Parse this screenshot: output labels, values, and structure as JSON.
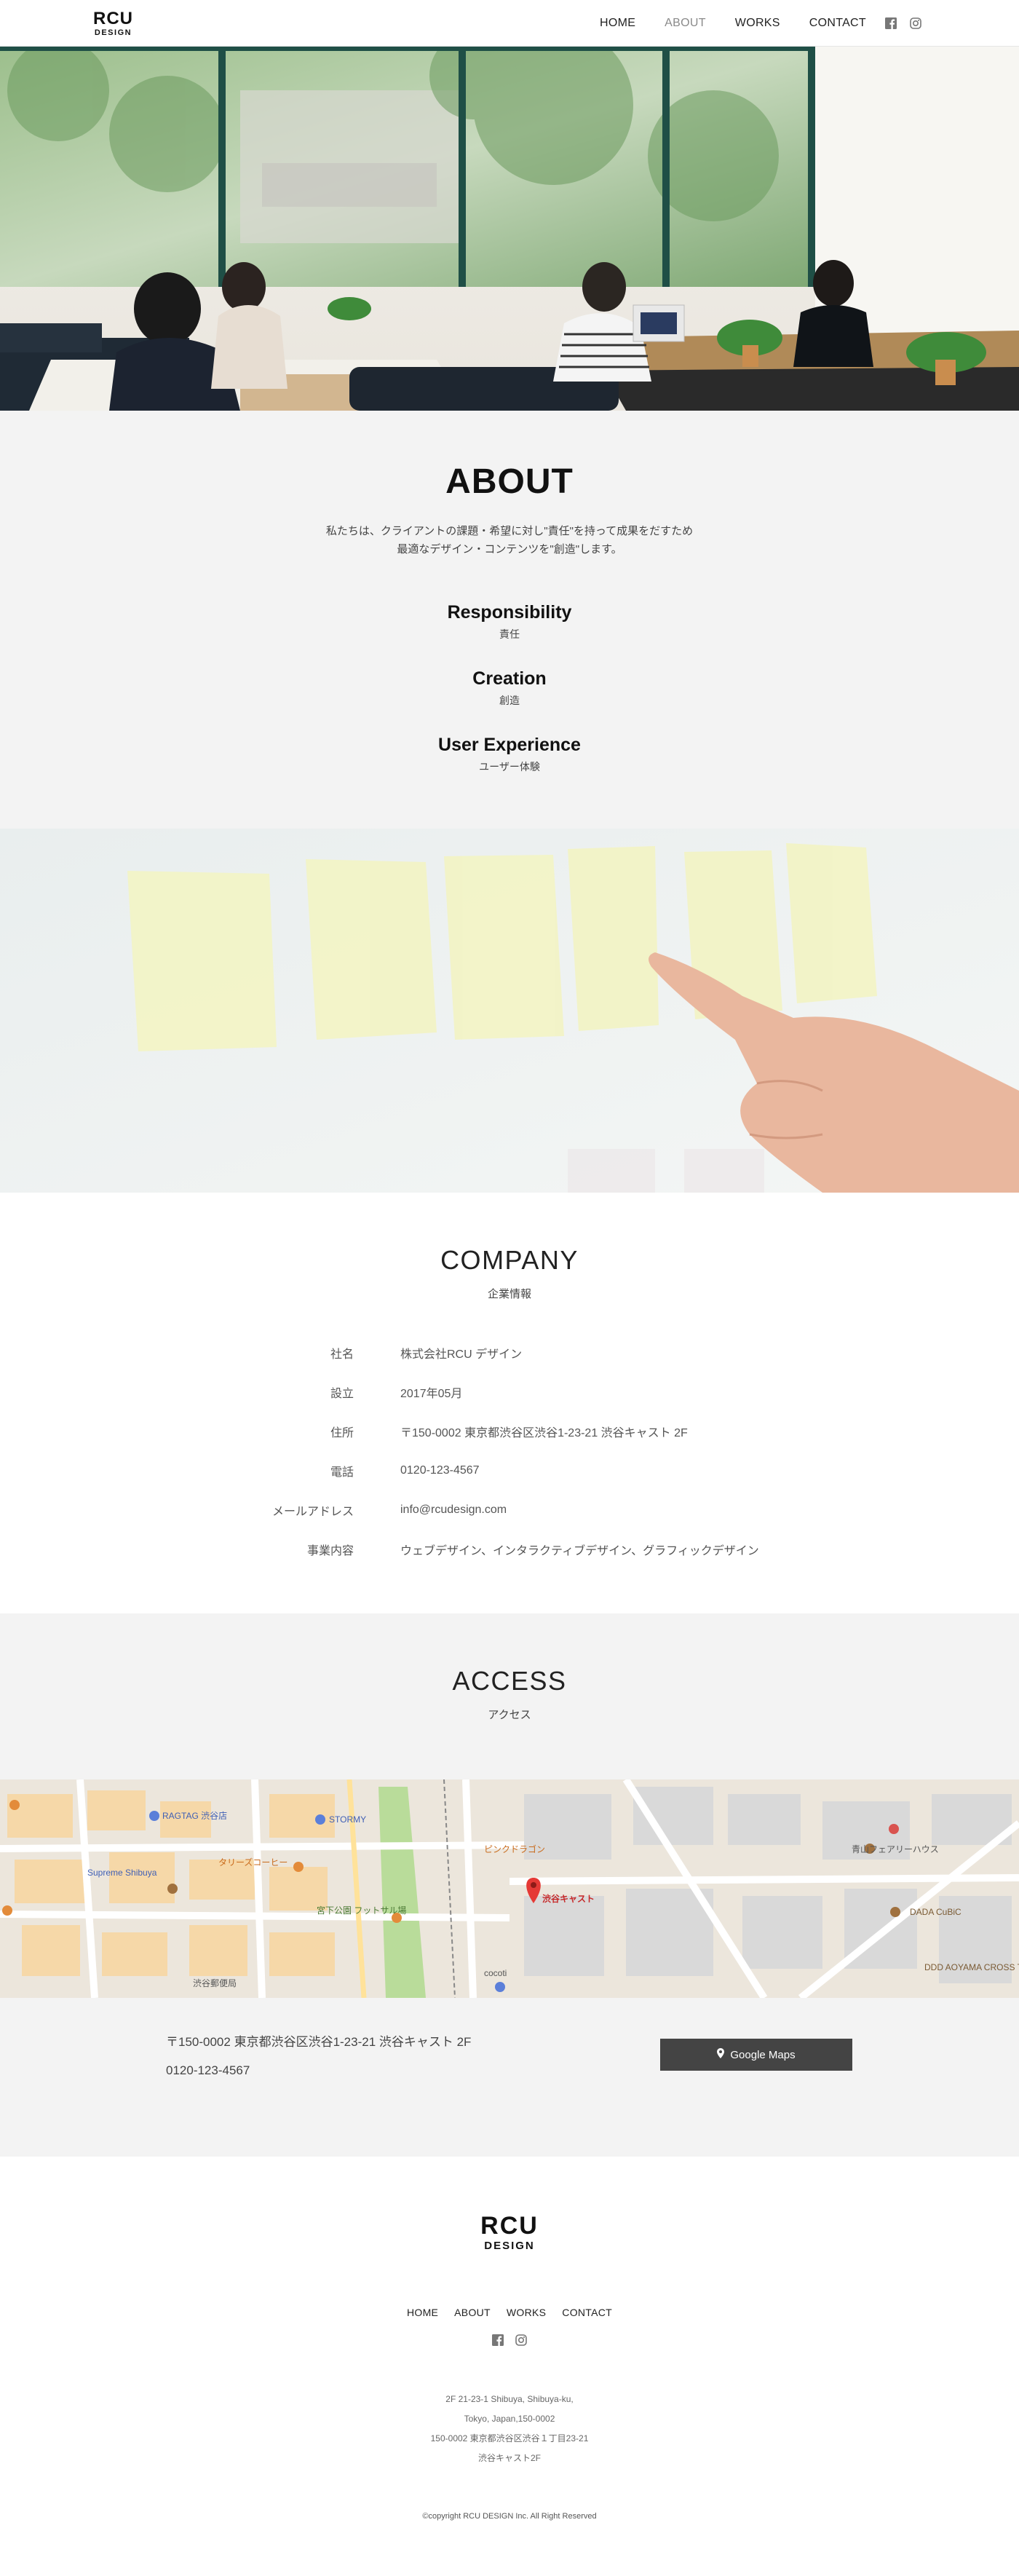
{
  "header": {
    "logo_line1": "RCU",
    "logo_line2": "DESIGN",
    "nav": [
      "HOME",
      "ABOUT",
      "WORKS",
      "CONTACT"
    ],
    "active_nav": "ABOUT",
    "social_icons": [
      "facebook-icon",
      "instagram-icon"
    ]
  },
  "about": {
    "title": "ABOUT",
    "lead_line1": "私たちは、クライアントの課題・希望に対し\"責任\"を持って成果をだすため",
    "lead_line2": "最適なデザイン・コンテンツを\"創造\"します。",
    "pillars": [
      {
        "title": "Responsibility",
        "sub": "責任"
      },
      {
        "title": "Creation",
        "sub": "創造"
      },
      {
        "title": "User Experience",
        "sub": "ユーザー体験"
      }
    ]
  },
  "company": {
    "title": "COMPANY",
    "subtitle": "企業情報",
    "rows": [
      {
        "label": "社名",
        "value": "株式会社RCU デザイン"
      },
      {
        "label": "設立",
        "value": "2017年05月"
      },
      {
        "label": "住所",
        "value": "〒150-0002 東京都渋谷区渋谷1-23-21 渋谷キャスト 2F"
      },
      {
        "label": "電話",
        "value": "0120-123-4567"
      },
      {
        "label": "メールアドレス",
        "value": "info@rcudesign.com"
      },
      {
        "label": "事業内容",
        "value": "ウェブデザイン、インタラクティブデザイン、グラフィックデザイン"
      }
    ]
  },
  "access": {
    "title": "ACCESS",
    "subtitle": "アクセス",
    "map_labels": {
      "ragtag": "RAGTAG 渋谷店",
      "stormy": "STORMY",
      "supreme": "Supreme Shibuya",
      "cast": "渋谷キャスト",
      "cocoti": "cocoti",
      "dada": "DADA CuBiC",
      "ddd": "DDD AOYAMA CROSS THEATER",
      "tully": "タリーズコーヒー",
      "miyashita": "宮下公園 フットサル場",
      "pinkdragon": "ピンクドラゴン",
      "aoyama_fairy": "青山フェアリーハウス",
      "shibuya_post": "渋谷郵便局"
    },
    "address": "〒150-0002 東京都渋谷区渋谷1-23-21 渋谷キャスト 2F",
    "tel": "0120-123-4567",
    "button_label": "Google Maps",
    "button_icon": "map-pin-icon"
  },
  "footer": {
    "logo_line1": "RCU",
    "logo_line2": "DESIGN",
    "nav": [
      "HOME",
      "ABOUT",
      "WORKS",
      "CONTACT"
    ],
    "social_icons": [
      "facebook-icon",
      "instagram-icon"
    ],
    "address_lines": [
      "2F 21-23-1 Shibuya, Shibuya-ku,",
      "Tokyo, Japan,150-0002",
      "150-0002 東京都渋谷区渋谷１丁目23-21",
      "渋谷キャスト2F"
    ],
    "copyright": "©copyright RCU DESIGN Inc. All Right Reserved"
  },
  "colors": {
    "section_bg": "#f3f3f3",
    "button_bg": "#444444",
    "nav_active": "#8a8a8a"
  }
}
